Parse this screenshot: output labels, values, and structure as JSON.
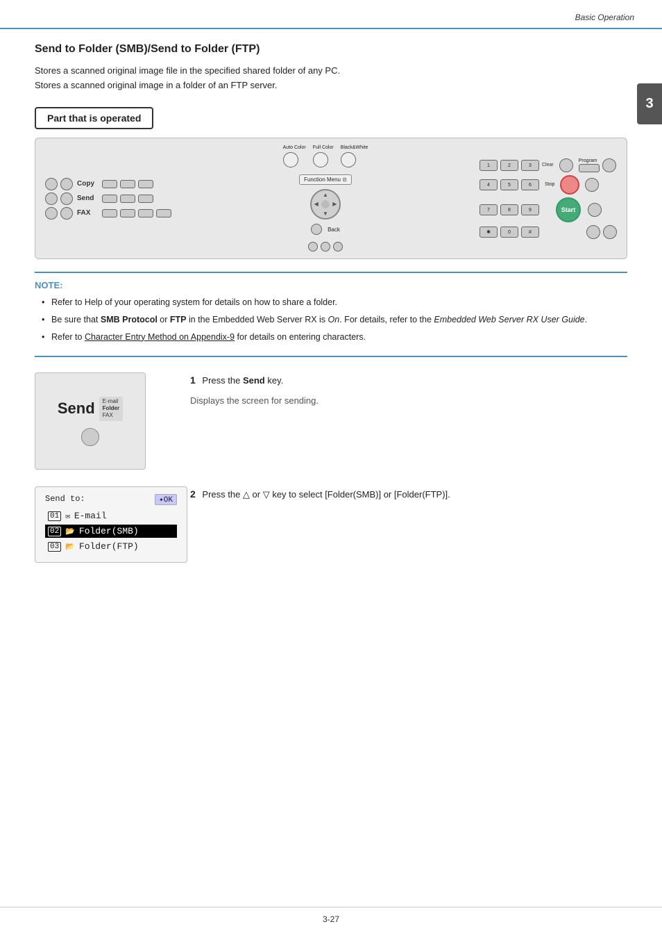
{
  "header": {
    "title": "Basic Operation"
  },
  "chapter": {
    "number": "3"
  },
  "section": {
    "title": "Send to Folder (SMB)/Send to Folder (FTP)",
    "desc1": "Stores a scanned original image file in the specified shared folder of any PC.",
    "desc2": "Stores a scanned original image in a folder of an FTP server.",
    "part_operated": "Part that is operated"
  },
  "note": {
    "title": "NOTE:",
    "items": [
      "Refer to Help of your operating system for details on how to share a folder.",
      "Be sure that SMB Protocol or FTP in the Embedded Web Server RX is On. For details, refer to the Embedded Web Server RX User Guide.",
      "Refer to Character Entry Method on Appendix-9 for details on entering characters."
    ],
    "bold_texts": [
      "SMB Protocol",
      "FTP"
    ],
    "italic_texts": [
      "On.",
      "Embedded Web Server RX User Guide"
    ],
    "link_texts": [
      "Character Entry Method on Appendix-9"
    ]
  },
  "step1": {
    "number": "1",
    "instruction": "Press the Send key.",
    "sub": "Displays the screen for sending.",
    "bold": "Send",
    "send_key_label": "Send",
    "send_key_labels": [
      "E-mail",
      "Folder",
      "FAX"
    ]
  },
  "step2": {
    "number": "2",
    "instruction_pre": "Press the",
    "key_delta": "△",
    "or": " or ",
    "key_nabla": "▽",
    "instruction_post": " key to select [Folder(SMB)] or [Folder(FTP)].",
    "screen": {
      "header": "Send to:",
      "ok_btn": "✦OK",
      "items": [
        {
          "num": "01",
          "icon": "✉",
          "label": "E-mail",
          "selected": false
        },
        {
          "num": "02",
          "icon": "📁",
          "label": "Folder(SMB)",
          "selected": true
        },
        {
          "num": "03",
          "icon": "📁",
          "label": "Folder(FTP)",
          "selected": false
        }
      ]
    }
  },
  "footer": {
    "page": "3-27"
  }
}
